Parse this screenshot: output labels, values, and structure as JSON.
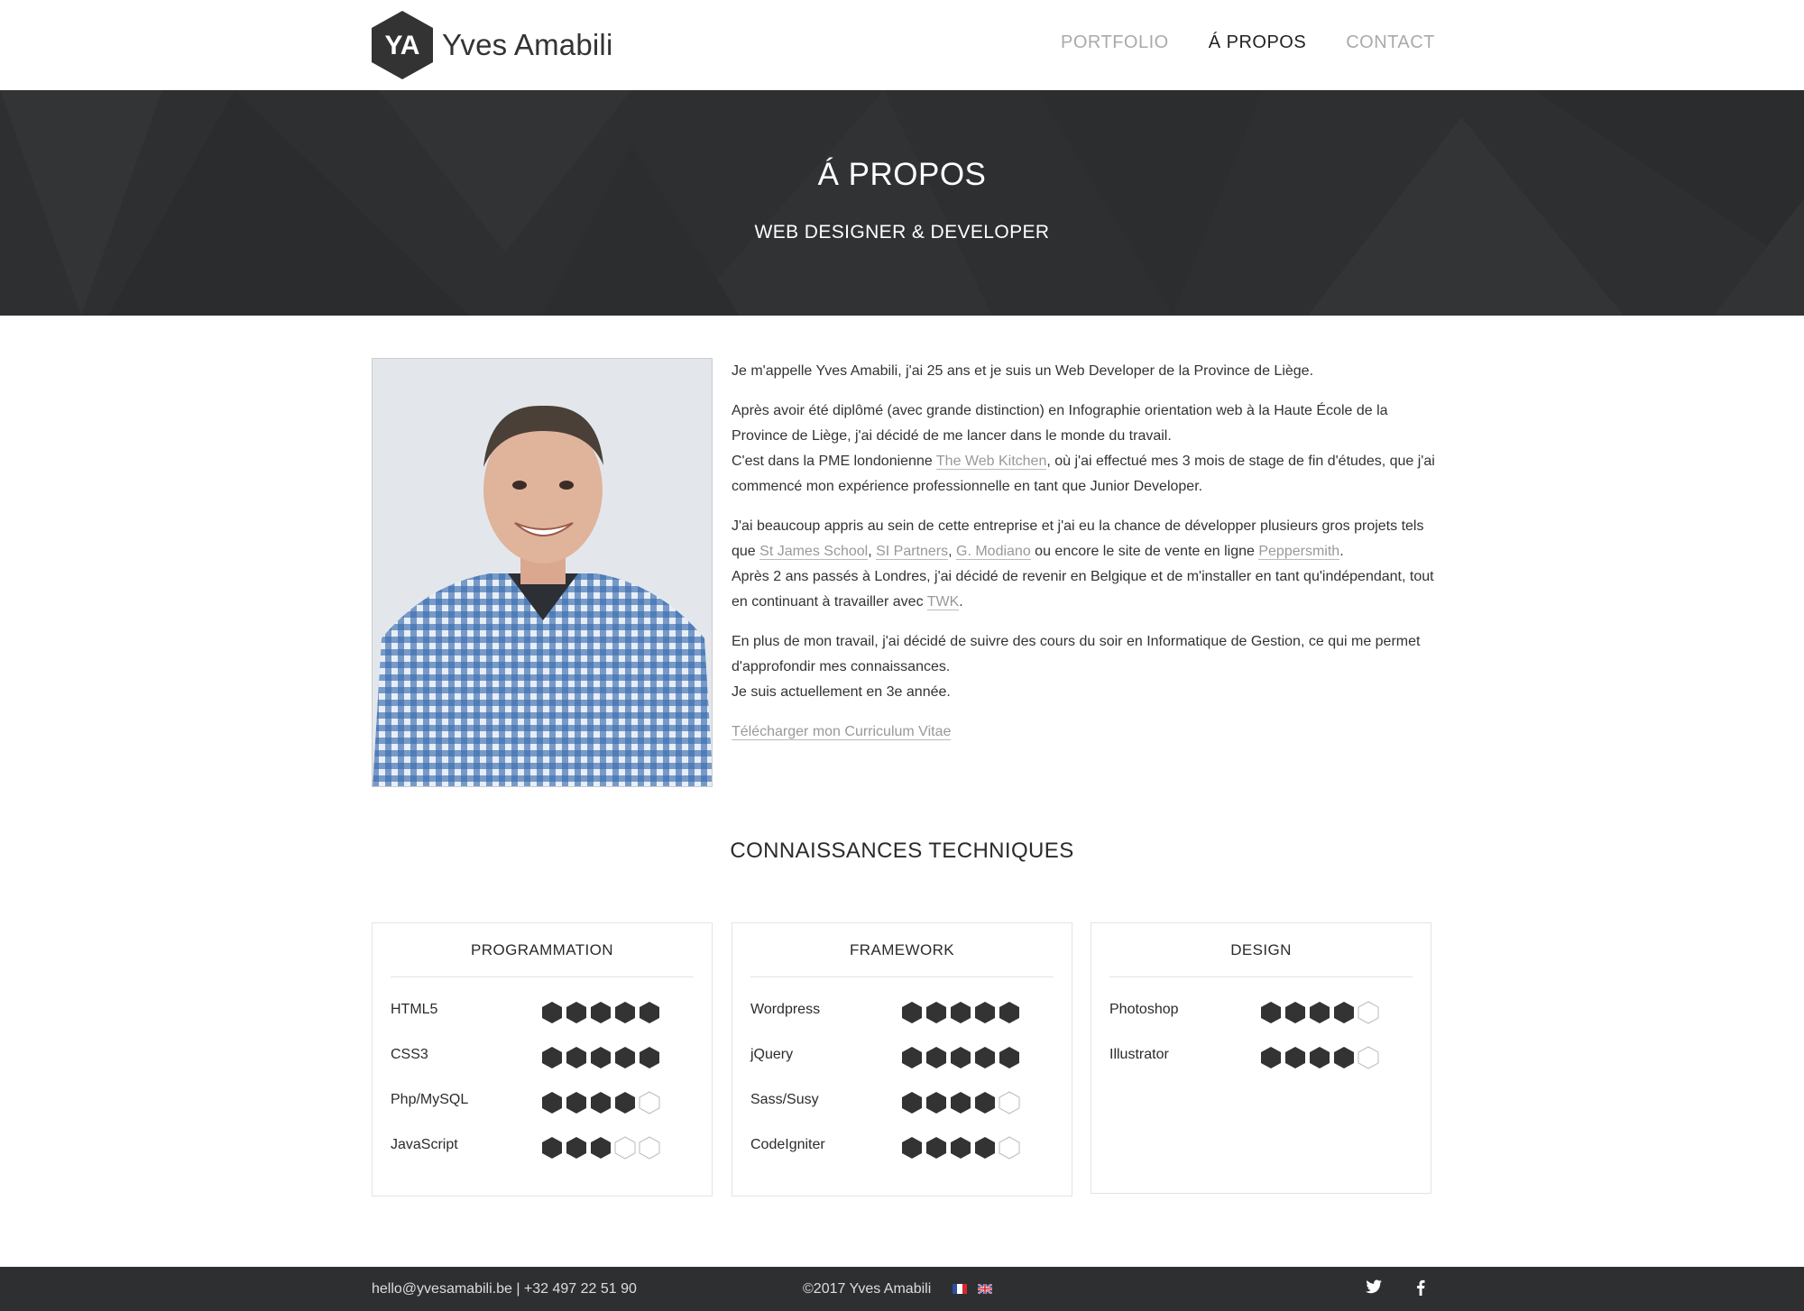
{
  "header": {
    "logo_initials": "YA",
    "brand": "Yves Amabili",
    "nav": [
      {
        "label": "PORTFOLIO",
        "active": false
      },
      {
        "label": "Á PROPOS",
        "active": true
      },
      {
        "label": "CONTACT",
        "active": false
      }
    ]
  },
  "hero": {
    "title": "Á PROPOS",
    "subtitle": "WEB DESIGNER & DEVELOPER"
  },
  "bio": {
    "p1": "Je m'appelle Yves Amabili, j'ai 25 ans et je suis un Web Developer de la Province de Liège.",
    "p2_a": "Après avoir été diplômé (avec grande distinction) en Infographie orientation web à la Haute École de la Province de Liège, j'ai décidé de me lancer dans le monde du travail.",
    "p2_b": "C'est dans la PME londonienne ",
    "p2_link": "The Web Kitchen",
    "p2_c": ", où j'ai effectué mes 3 mois de stage de fin d'études, que j'ai commencé mon expérience professionnelle en tant que Junior Developer.",
    "p3_a": "J'ai beaucoup appris au sein de cette entreprise et j'ai eu la chance de développer plusieurs gros projets tels que ",
    "p3_link1": "St James School",
    "p3_sep1": ", ",
    "p3_link2": "SI Partners",
    "p3_sep2": ",  ",
    "p3_link3": "G. Modiano",
    "p3_b": " ou encore le site de vente en ligne ",
    "p3_link4": "Peppersmith",
    "p3_c": ".",
    "p3_d": "Après 2 ans passés à Londres, j'ai décidé de revenir en Belgique et de m'installer en tant qu'indépendant, tout en continuant à travailler avec ",
    "p3_link5": "TWK",
    "p3_e": ".",
    "p4_a": "En plus de mon travail, j'ai décidé de suivre des cours du soir en Informatique de Gestion, ce qui me permet d'approfondir mes connaissances.",
    "p4_b": "Je suis actuellement en 3e année.",
    "cv_link": "Télécharger mon Curriculum Vitae"
  },
  "skills": {
    "title": "CONNAISSANCES TECHNIQUES",
    "max_level": 5,
    "categories": [
      {
        "title": "PROGRAMMATION",
        "items": [
          {
            "name": "HTML5",
            "level": 5
          },
          {
            "name": "CSS3",
            "level": 5
          },
          {
            "name": "Php/MySQL",
            "level": 4
          },
          {
            "name": "JavaScript",
            "level": 3
          }
        ]
      },
      {
        "title": "FRAMEWORK",
        "items": [
          {
            "name": "Wordpress",
            "level": 5
          },
          {
            "name": "jQuery",
            "level": 5
          },
          {
            "name": "Sass/Susy",
            "level": 4
          },
          {
            "name": "CodeIgniter",
            "level": 4
          }
        ]
      },
      {
        "title": "DESIGN",
        "items": [
          {
            "name": "Photoshop",
            "level": 4
          },
          {
            "name": "Illustrator",
            "level": 4
          }
        ]
      }
    ]
  },
  "footer": {
    "contact": "hello@yvesamabili.be | +32 497 22 51 90",
    "copyright": "©2017 Yves Amabili",
    "flags": [
      "flag-fr-icon",
      "flag-uk-icon"
    ],
    "social": [
      "twitter-icon",
      "facebook-icon"
    ]
  },
  "colors": {
    "dark": "#2e2f31",
    "hex_fill": "#333333",
    "link": "#999999"
  }
}
